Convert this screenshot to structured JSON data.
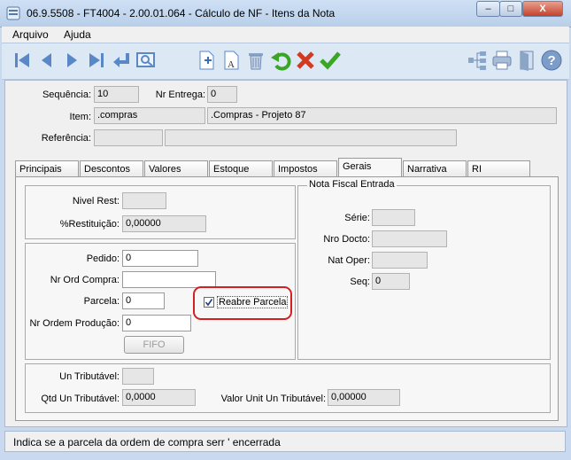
{
  "window": {
    "title": "06.9.5508 - FT4004 - 2.00.01.064 - Cálculo de NF - Itens da Nota",
    "minimize_label": "–",
    "maximize_label": "□",
    "close_label": "X"
  },
  "menu": {
    "arquivo": "Arquivo",
    "ajuda": "Ajuda"
  },
  "header": {
    "sequencia_label": "Sequência:",
    "sequencia_value": "10",
    "nr_entrega_label": "Nr Entrega:",
    "nr_entrega_value": "0",
    "item_label": "Item:",
    "item_code": ".compras",
    "item_desc": ".Compras - Projeto 87",
    "referencia_label": "Referência:",
    "referencia_value": "",
    "referencia_desc": ""
  },
  "tabs": [
    {
      "label": "Principais"
    },
    {
      "label": "Descontos"
    },
    {
      "label": "Valores"
    },
    {
      "label": "Estoque"
    },
    {
      "label": "Impostos"
    },
    {
      "label": "Gerais"
    },
    {
      "label": "Narrativa"
    },
    {
      "label": "RI"
    }
  ],
  "gerais": {
    "nivel_rest_label": "Nivel Rest:",
    "nivel_rest_value": "",
    "restituicao_label": "%Restituição:",
    "restituicao_value": "0,00000",
    "pedido_label": "Pedido:",
    "pedido_value": "0",
    "nr_ord_compra_label": "Nr Ord Compra:",
    "nr_ord_compra_value": "",
    "parcela_label": "Parcela:",
    "parcela_value": "0",
    "reabre_parcela_label": "Reabre Parcela",
    "nr_ordem_producao_label": "Nr Ordem Produção:",
    "nr_ordem_producao_value": "0",
    "fifo_label": "FIFO",
    "nf_entrada_title": "Nota Fiscal Entrada",
    "serie_label": "Série:",
    "serie_value": "",
    "nro_docto_label": "Nro Docto:",
    "nro_docto_value": "",
    "nat_oper_label": "Nat Oper:",
    "nat_oper_value": "",
    "seq_label": "Seq:",
    "seq_value": "0",
    "un_tributavel_label": "Un Tributável:",
    "un_tributavel_value": "",
    "qtd_un_tributavel_label": "Qtd Un Tributável:",
    "qtd_un_tributavel_value": "0,0000",
    "valor_unit_label": "Valor Unit Un Tributável:",
    "valor_unit_value": "0,00000"
  },
  "status": {
    "text": "Indica se a parcela da ordem de compra serr ' encerrada"
  },
  "colors": {
    "accent": "#2a6fc0",
    "highlight_ring": "#d42020",
    "confirm_green": "#3aa526",
    "cancel_red": "#d33a22"
  }
}
